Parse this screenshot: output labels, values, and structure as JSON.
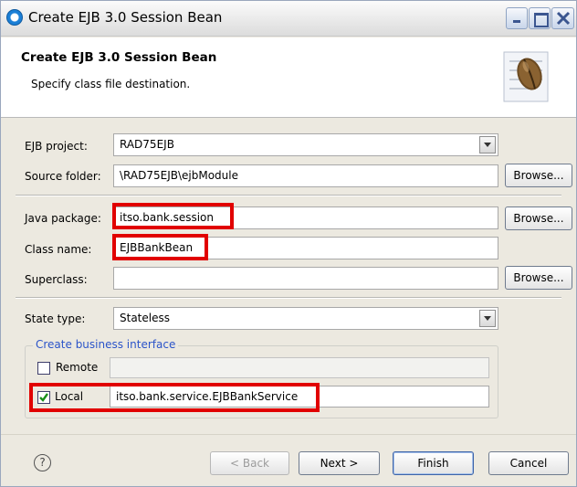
{
  "window": {
    "title": "Create EJB 3.0 Session Bean"
  },
  "header": {
    "title": "Create EJB 3.0 Session Bean",
    "subtitle": "Specify class file destination."
  },
  "form": {
    "ejb_project": {
      "label": "EJB project:",
      "value": "RAD75EJB"
    },
    "source_folder": {
      "label": "Source folder:",
      "value": "\\RAD75EJB\\ejbModule",
      "browse": "Browse..."
    },
    "java_package": {
      "label": "Java package:",
      "value": "itso.bank.session",
      "browse": "Browse..."
    },
    "class_name": {
      "label": "Class name:",
      "value": "EJBBankBean"
    },
    "superclass": {
      "label": "Superclass:",
      "value": "",
      "browse": "Browse..."
    },
    "state_type": {
      "label": "State type:",
      "value": "Stateless"
    },
    "business_interface": {
      "legend": "Create business interface",
      "remote": {
        "label": "Remote",
        "checked": false,
        "value": ""
      },
      "local": {
        "label": "Local",
        "checked": true,
        "value": "itso.bank.service.EJBBankService"
      }
    }
  },
  "buttons": {
    "help": "?",
    "back": "< Back",
    "next": "Next >",
    "finish": "Finish",
    "cancel": "Cancel"
  },
  "icons": {
    "title": "eclipse-dialog-icon",
    "banner": "ejb-bean-icon",
    "help": "help-icon"
  },
  "colors": {
    "highlight": "#e10000",
    "legend": "#2b54c9"
  }
}
